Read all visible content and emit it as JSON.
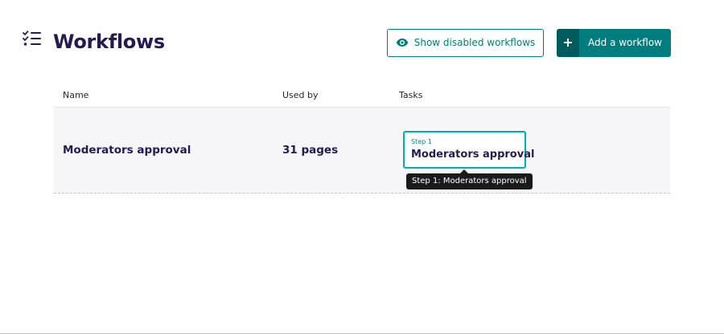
{
  "header": {
    "title": "Workflows",
    "title_icon": "tasks-list-icon",
    "show_disabled_label": "Show disabled workflows",
    "add_workflow_label": "Add a workflow"
  },
  "table": {
    "columns": [
      "Name",
      "Used by",
      "Tasks"
    ],
    "rows": [
      {
        "name": "Moderators approval",
        "used_by": "31 pages",
        "tasks": [
          {
            "step": "Step 1",
            "name": "Moderators approval",
            "tooltip": "Step 1: Moderators approval"
          }
        ]
      }
    ]
  },
  "colors": {
    "primary": "#007d7e",
    "primary_dark": "#005b5e",
    "task_border": "#00b0b1",
    "heading": "#261a55",
    "row_background": "#f6f6f8",
    "tooltip_background": "#1a1a1a"
  }
}
